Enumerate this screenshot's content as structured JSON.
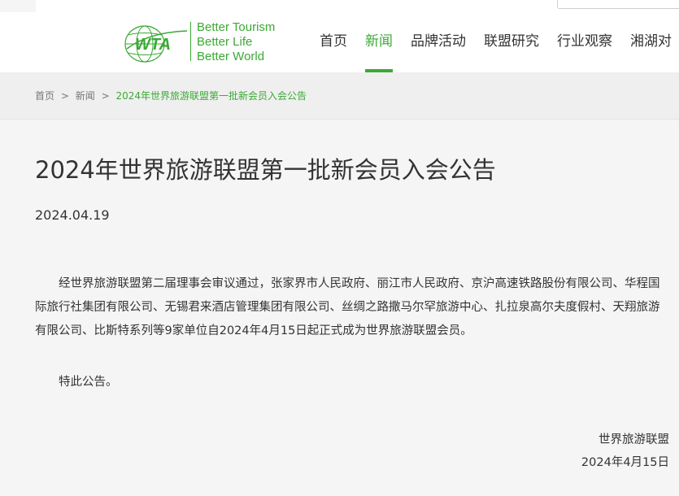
{
  "header": {
    "logo": {
      "mark_text": "WTA",
      "tagline": [
        "Better Tourism",
        "Better Life",
        "Better World"
      ]
    },
    "nav": [
      {
        "label": "首页",
        "active": false
      },
      {
        "label": "新闻",
        "active": true
      },
      {
        "label": "品牌活动",
        "active": false
      },
      {
        "label": "联盟研究",
        "active": false
      },
      {
        "label": "行业观察",
        "active": false
      },
      {
        "label": "湘湖对",
        "active": false
      }
    ]
  },
  "breadcrumb": {
    "items": [
      "首页",
      "新闻"
    ],
    "separator": ">",
    "current": "2024年世界旅游联盟第一批新会员入会公告"
  },
  "article": {
    "title": "2024年世界旅游联盟第一批新会员入会公告",
    "date": "2024.04.19",
    "paragraphs": [
      "经世界旅游联盟第二届理事会审议通过，张家界市人民政府、丽江市人民政府、京沪高速铁路股份有限公司、华程国际旅行社集团有限公司、无锡君来酒店管理集团有限公司、丝绸之路撒马尔罕旅游中心、扎拉泉高尔夫度假村、天翔旅游有限公司、比斯特系列等9家单位自2024年4月15日起正式成为世界旅游联盟会员。",
      "特此公告。"
    ],
    "signature": "世界旅游联盟",
    "signature_date": "2024年4月15日"
  },
  "colors": {
    "accent": "#3ba935",
    "text": "#333333",
    "background": "#f5f5f5"
  }
}
